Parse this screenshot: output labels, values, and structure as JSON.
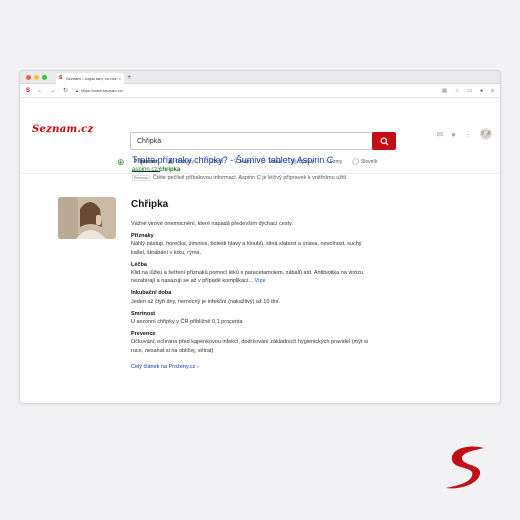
{
  "browser": {
    "tab_title": "Seznam – najdu tam, co neznám",
    "tab_close": "×",
    "new_tab": "+",
    "url": "https://www.seznam.cz/",
    "traffic_colors": [
      "#f25f58",
      "#fbbe2e",
      "#33c748"
    ]
  },
  "header": {
    "logo_text": "Seznam.cz",
    "search_value": "Chřipka",
    "clear": "×"
  },
  "verticals": [
    {
      "label": "Internet",
      "icon": "search-icon",
      "glyph": "⌕",
      "active": true
    },
    {
      "label": "Obrázky",
      "icon": "image-icon",
      "glyph": "▣",
      "active": false
    },
    {
      "label": "Zboží",
      "icon": "tag-icon",
      "glyph": "◇",
      "active": false
    },
    {
      "label": "Mapy",
      "icon": "map-pin-icon",
      "glyph": "⚲",
      "active": false
    },
    {
      "label": "Videa",
      "icon": "play-icon",
      "glyph": "▷",
      "active": false
    },
    {
      "label": "Zprávy",
      "icon": "news-icon",
      "glyph": "▤",
      "active": false
    },
    {
      "label": "Firmy",
      "icon": "building-icon",
      "glyph": "⌂",
      "active": false
    },
    {
      "label": "Slovník",
      "icon": "dictionary-icon",
      "glyph": "◯",
      "active": false
    }
  ],
  "ad": {
    "title": "Trpíte příznaky chřipky? - Šumivé tablety Aspirin C",
    "url_domain": "aspirin.cz/",
    "url_path": "chripka",
    "badge": "Reklama",
    "description": "Čtěte pečlivě příbalovou informaci. Aspirin C je léčivý přípravek k vnitřnímu užití"
  },
  "knowledge": {
    "title": "Chřipka",
    "intro": "Vážné virové onemocnění, které napadá především dýchací cesty.",
    "sections": [
      {
        "heading": "Příznaky",
        "text": "Náhlý nástup, horečka, zimnice, bolesti hlavy a kloubů, silná slabost a únava, nevolnost, suchý kašel, škrábání v krku, rýma."
      },
      {
        "heading": "Léčba",
        "text": "Klid na lůžku a šetření příznaků pomocí léků s paracetamolem, zábalů atd. Antibiotika na virózu nezabírají a nasazují se až v případě komplikací...",
        "more": " Více"
      },
      {
        "heading": "Inkubační doba",
        "text": "Jeden až čtyři dny, nemocný je infekční (nakažlivý) až 10 dní."
      },
      {
        "heading": "Smrtnost",
        "text": "U sezonní chřipky v ČR přibližně 0,1 procenta"
      },
      {
        "heading": "Prevence",
        "text": "Očkování, ochrana před kapénkovou infekcí, dodržování základních hygienických pravidel (mýt si ruce, nesahat si na obličej, větrat)"
      }
    ],
    "full_article_link": "Celý článek na Proženy.cz ›"
  },
  "colors": {
    "brand_red": "#c20e16",
    "link_blue": "#0b3fa8",
    "url_green": "#19782b"
  }
}
